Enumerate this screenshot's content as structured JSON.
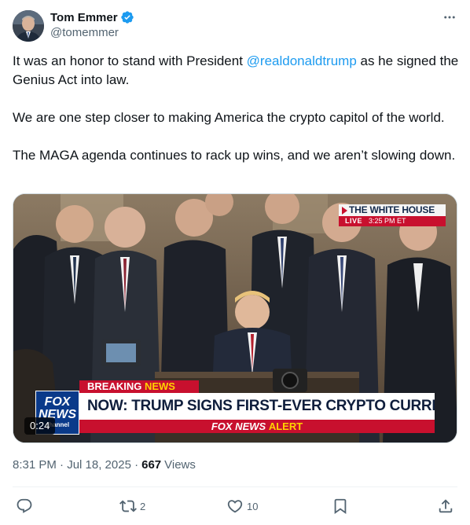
{
  "author": {
    "display_name": "Tom Emmer",
    "handle": "@tomemmer",
    "verified": true
  },
  "tweet": {
    "paragraphs": [
      {
        "before": "It was an honor to stand with President ",
        "mention": "@realdonaldtrump",
        "after": " as he signed the Genius Act into law."
      },
      {
        "text": "We are one step closer to making America the crypto capitol of the world."
      },
      {
        "text": "The MAGA agenda continues to rack up wins, and we aren’t slowing down."
      }
    ],
    "media": {
      "type": "video",
      "duration": "0:24",
      "broadcast": {
        "bug_title": "THE WHITE HOUSE",
        "bug_live": "LIVE",
        "bug_time": "3:25 PM ET",
        "breaking_label": "BREAKING",
        "breaking_news_word": "NEWS",
        "headline": "NOW: TRUMP SIGNS FIRST-EVER CRYPTO CURRENCY BILL",
        "alert_prefix": "FOX NEWS",
        "alert_word": "ALERT",
        "logo_text_top": "FOX",
        "logo_text_bottom": "NEWS",
        "logo_text_small": "channel"
      }
    },
    "timestamp": "8:31 PM · Jul 18, 2025",
    "views_count": "667",
    "views_label": "Views"
  },
  "actions": {
    "reply_count": "",
    "retweet_count": "2",
    "like_count": "10"
  },
  "colors": {
    "link": "#1d9bf0",
    "secondary_text": "#536471",
    "verified": "#1d9bf0",
    "breaking_red": "#c8102e"
  },
  "icons": [
    "verified-badge-icon",
    "more-icon",
    "reply-icon",
    "retweet-icon",
    "like-icon",
    "bookmark-icon",
    "share-icon"
  ]
}
